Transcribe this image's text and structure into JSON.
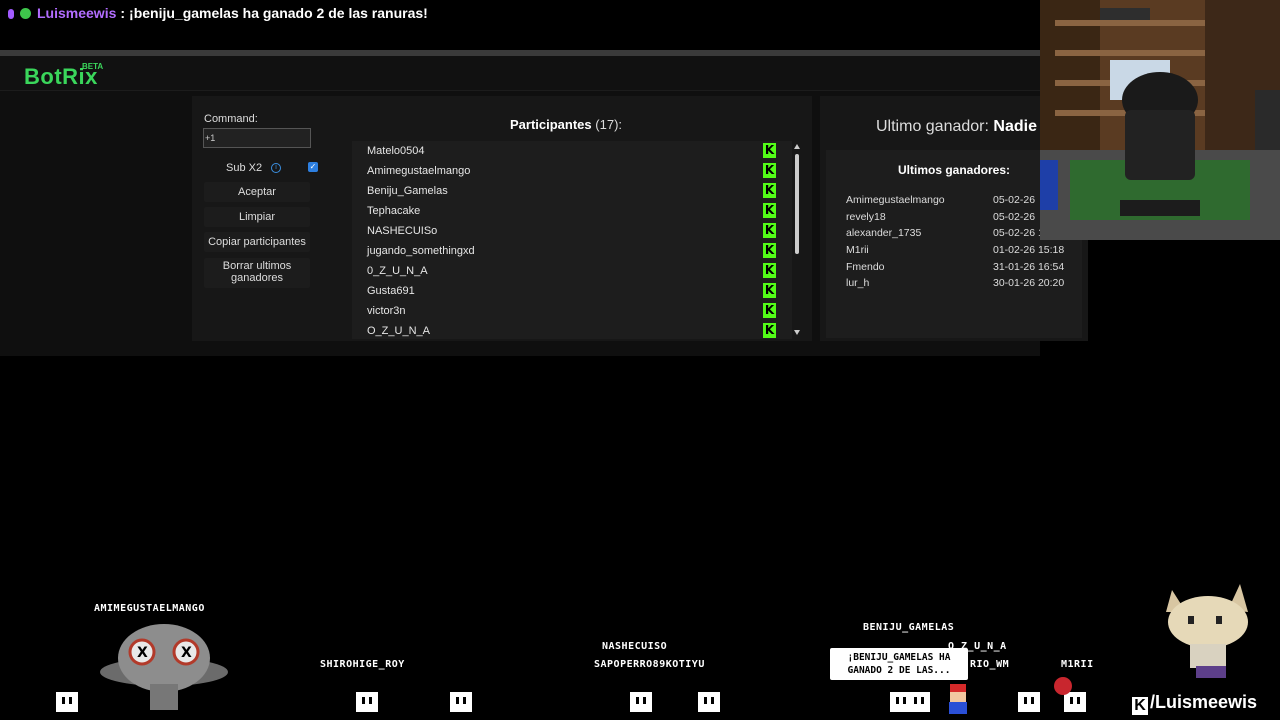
{
  "chat": {
    "username": "Luismeewis",
    "separator": ":",
    "message": "¡beniju_gamelas ha ganado 2 de las ranuras!"
  },
  "app": {
    "logo": "BotRix",
    "beta": "BETA"
  },
  "controls": {
    "command_label": "Command:",
    "command_value": "+1",
    "sub_label": "Sub X2",
    "sub_checked": true,
    "accept_label": "Aceptar",
    "clear_label": "Limpiar",
    "copy_label": "Copiar participantes",
    "delete_label_line1": "Borrar ultimos",
    "delete_label_line2": "ganadores"
  },
  "participants": {
    "title": "Participantes",
    "count": "(17):",
    "names": [
      "Matelo0504",
      "Amimegustaelmango",
      "Beniju_Gamelas",
      "Tephacake",
      "NASHECUISo",
      "jugando_somethingxd",
      "0_Z_U_N_A",
      "Gusta691",
      "victor3n",
      "O_Z_U_N_A"
    ]
  },
  "winners": {
    "last_label": "Ultimo ganador:",
    "last_value": "Nadie",
    "title": "Ultimos ganadores:",
    "list": [
      {
        "name": "Amimegustaelmango",
        "date": "05-02-26"
      },
      {
        "name": "revely18",
        "date": "05-02-26"
      },
      {
        "name": "alexander_1735",
        "date": "05-02-26 1"
      },
      {
        "name": "M1rii",
        "date": "01-02-26 15:18"
      },
      {
        "name": "Fmendo",
        "date": "31-01-26 16:54"
      },
      {
        "name": "lur_h",
        "date": "30-01-26 20:20"
      }
    ]
  },
  "game": {
    "labels": {
      "amime": "AMIMEGUSTAELMANGO",
      "shirohige": "SHIROHIGE_ROY",
      "nashe": "NASHECUISO",
      "sapo": "SAPOPERRO89KOTIYU",
      "beniju": "BENIJU_GAMELAS",
      "ozuna": "O_Z_U_N_A",
      "mario": "RIO_WM",
      "m1rii": "M1RII"
    },
    "speech_line1": "¡BENIJU_GAMELAS HA",
    "speech_line2": "GANADO 2 DE LAS..."
  },
  "brand": {
    "kick_handle": "/Luismeewis"
  },
  "colors": {
    "accent": "#3ad65b",
    "kick": "#53fc18",
    "username": "#b26dff"
  }
}
